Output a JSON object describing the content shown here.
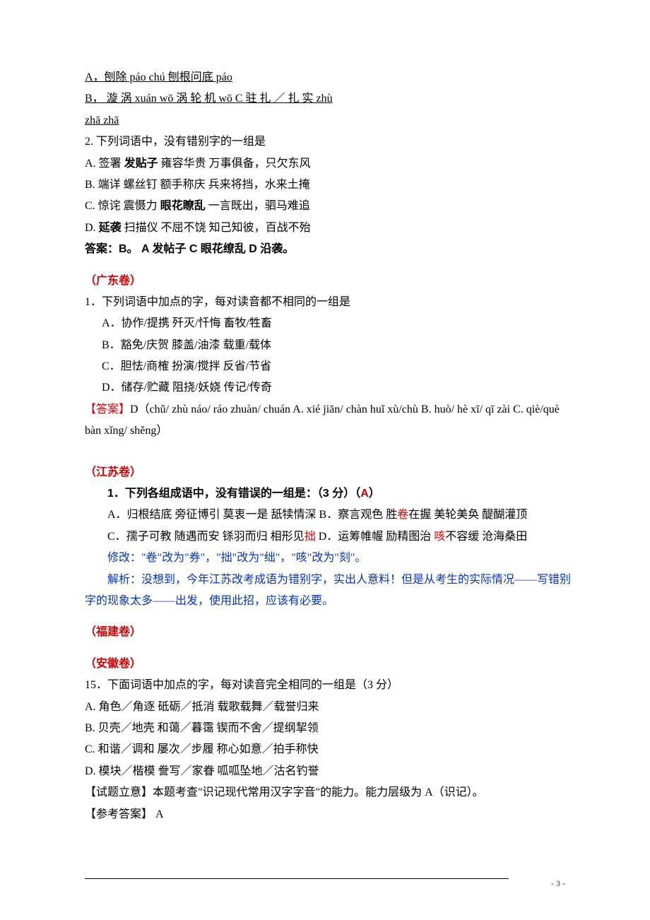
{
  "shandong": {
    "line1_a": "A，刨除 páo chú           刨根问底    páo",
    "line2_b": "B， 漩 涡   xuán wō                 涡 轮 机    wō                 C 驻 扎 ／ 扎 实    zhù",
    "line3": "zhā   zhā  ",
    "q2_stem": "2. 下列词语中，没有错别字的一组是",
    "q2_a_pre": "A. 签署 ",
    "q2_a_bold": "发贴子",
    "q2_a_post": " 雍容华贵 万事俱备，只欠东风",
    "q2_b": "B. 端详 螺丝钉 额手称庆 兵来将挡，水来土掩",
    "q2_c_pre": "C. 惊诧 震慑力 ",
    "q2_c_bold": "眼花瞭乱",
    "q2_c_post": " 一言既出，驷马难追",
    "q2_d_pre": "D. ",
    "q2_d_bold": "延袭",
    "q2_d_post": " 扫描仪 不屈不饶 知己知彼，百战不殆",
    "q2_ans_pre": "答案：B。     A 发帖子   C 眼花缭乱     D 沿袭。"
  },
  "guangdong": {
    "title": "（广东卷）",
    "q1_stem": "1．下列词语中加点的字，每对读音都不相同的一组是",
    "q1_a": "A．协作/提携   歼灭/忏悔   畜牧/牲畜",
    "q1_b": "B．豁免/庆贺   膝盖/油漆   载重/载体",
    "q1_c": "C．胆怯/商榷   扮演/搅拌   反省/节省",
    "q1_d": "D．储存/贮藏   阻挠/妖娆   传记/传奇",
    "answer_label": "【答案】",
    "answer_body": "D（chǔ/ zhù  náo/ ráo  zhuàn/ chuán  A. xié  jiān/ chàn huǐ xù/chù  B. huò/ hè  xī/ qī zài  C. qiè/què  bàn  xǐng/ shěng）"
  },
  "jiangsu": {
    "title": "（江苏卷）",
    "q1_stem_pre": "1．下列各组成语中，没有错误的一组是：（3 分）（",
    "q1_stem_ans": "A",
    "q1_stem_post": "）",
    "line1_pre": "A．归根结底   旁征博引   莫衷一是   舐犊情深   B．察言观色   胜",
    "line1_wrong": "卷",
    "line1_post": "在握   美轮美奂   醍醐灌顶",
    "line2_pre": "C．孺子可教   随遇而安   铩羽而归   相形见",
    "line2_wrong1": "拙",
    "line2_mid": "   D．运筹帷幄   励精图治   ",
    "line2_wrong2": "咳",
    "line2_post": "不容缓   沧海桑田",
    "fix": "修改：\"卷\"改为\"券\"，\"拙\"改为\"绌\"，\"咳\"改为\"刻\"。",
    "analysis": "解析：没想到，今年江苏改考成语为错别字，实出人意料！但是从考生的实际情况——写错别字的现象太多——出发，使用此招，应该有必要。"
  },
  "fujian": {
    "title": "（福建卷）"
  },
  "anhui": {
    "title": "（安徽卷）",
    "q_stem": "15．下面词语中加点的字，每对读音完全相同的一组是（3 分）",
    "opt_a": "A. 角色／角逐    砥砺／抵消    载歌载舞／载誉归来",
    "opt_b": "B. 贝壳／地壳    和蔼／暮霭    锲而不舍／提纲挈领",
    "opt_c": "C. 和谐／调和    屡次／步履    称心如意／拍手称快",
    "opt_d": "D. 模块／楷模    誊写／家眷    呱呱坠地／沽名钓誉",
    "intent": "【试题立意】本题考查\"识记现代常用汉字字音\"的能力。能力层级为 A（识记）。",
    "answer": "【参考答案】 A"
  },
  "footer": {
    "page": "- 3 -"
  }
}
